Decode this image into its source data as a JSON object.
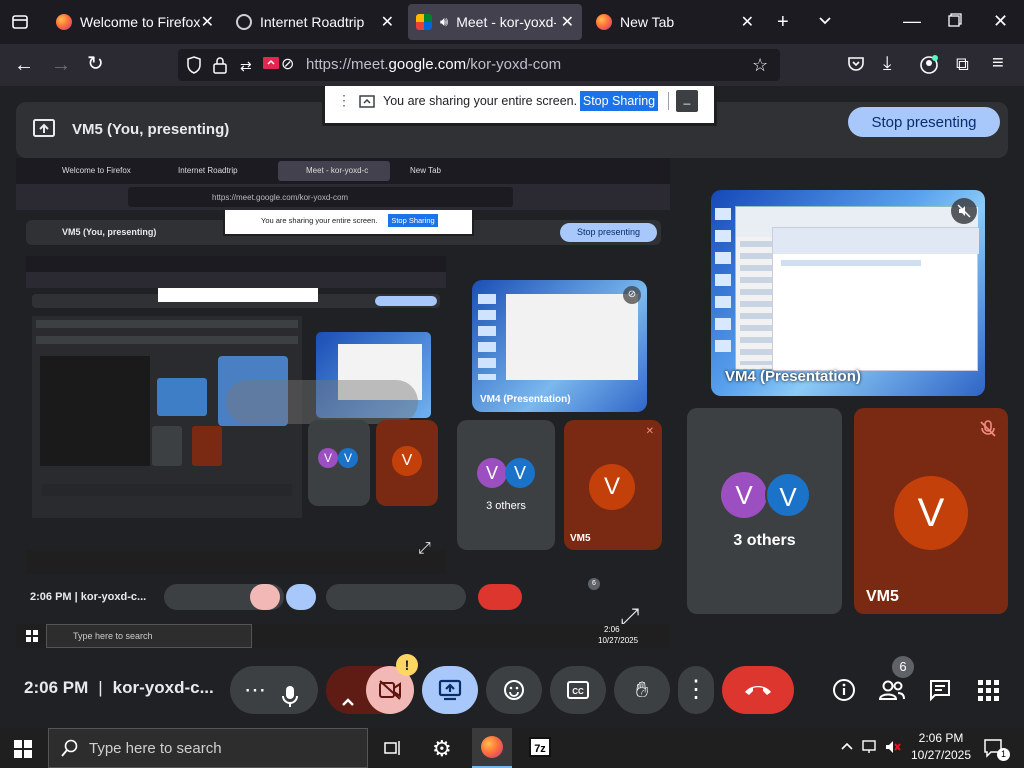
{
  "browser": {
    "tabs": [
      {
        "title": "Welcome to Firefox",
        "icon": "firefox-icon",
        "active": false
      },
      {
        "title": "Internet Roadtrip",
        "icon": "globe-icon",
        "active": false
      },
      {
        "title": "Meet - kor-yoxd-com",
        "icon": "google-meet-icon",
        "active": true
      },
      {
        "title": "New Tab",
        "icon": "firefox-icon",
        "active": false
      }
    ],
    "url_prefix": "https://meet.",
    "url_domain": "google.com",
    "url_path": "/kor-yoxd-com"
  },
  "meet": {
    "presenter_label": "VM5 (You, presenting)",
    "stop_presenting_label": "Stop presenting",
    "share_banner_text": "You are sharing your entire screen.",
    "stop_sharing_label": "Stop Sharing",
    "banner_minimize": "_",
    "tiles": {
      "presentation_label": "VM4 (Presentation)",
      "others_label": "3 others",
      "others_initials": [
        "V",
        "V"
      ],
      "vm5_initial": "V",
      "vm5_label": "VM5"
    },
    "controls": {
      "time": "2:06 PM",
      "separator": "|",
      "meeting_code": "kor-yoxd-c...",
      "participants_count": "6",
      "alert_badge": "!"
    },
    "mirror": {
      "presenter_label": "VM5 (You, presenting)",
      "stop_presenting_label": "Stop presenting",
      "share_banner_text": "You are sharing your entire screen.",
      "stop_sharing_label": "Stop Sharing",
      "url": "https://meet.google.com/kor-yoxd-com",
      "tab1": "Welcome to Firefox",
      "tab2": "Internet Roadtrip",
      "tab3": "Meet - kor-yoxd-c",
      "tab4": "New Tab",
      "presentation_label": "VM4 (Presentation)",
      "others_label": "3 others",
      "vm5_label": "VM5",
      "time": "2:06 PM",
      "meeting_code": "kor-yoxd-c...",
      "participants_count": "6",
      "search_placeholder": "Type here to search",
      "tray_time": "2:06",
      "tray_date": "10/27/2025"
    }
  },
  "taskbar": {
    "search_placeholder": "Type here to search",
    "time": "2:06 PM",
    "date": "10/27/2025",
    "notification_count": "1"
  },
  "colors": {
    "meet_bg": "#202124",
    "tile_bg": "#3c4043",
    "blue_button": "#a8c7fa",
    "end_call": "#dc362e",
    "vm5_bg": "#7a2a12",
    "avatar_purple": "#9c4fc1",
    "avatar_blue": "#1a73c8",
    "avatar_orange": "#c4400b"
  }
}
